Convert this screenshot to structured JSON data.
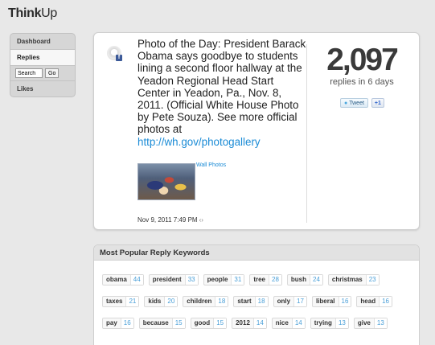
{
  "app": {
    "logo_think": "Think",
    "logo_up": "Up"
  },
  "sidebar": {
    "items": [
      {
        "label": "Dashboard"
      },
      {
        "label": "Replies"
      },
      {
        "label": "Likes"
      }
    ],
    "search_value": "Search",
    "go_label": "Go"
  },
  "post": {
    "text": "Photo of the Day: President Barack Obama says goodbye to students lining a second floor hallway at the Yeadon Regional Head Start Center in Yeadon, Pa., Nov. 8, 2011. (Official White House Photo by Pete Souza). See more official photos at",
    "link": "http://wh.gov/photogallery",
    "photo_caption": "Wall Photos",
    "timestamp": "Nov 9, 2011 7:49 PM",
    "source_badge": "f"
  },
  "stats": {
    "count": "2,097",
    "label": "replies in 6 days",
    "tweet_label": "Tweet",
    "plus_label": "+1"
  },
  "keywords": {
    "title": "Most Popular Reply Keywords",
    "rows": [
      [
        {
          "word": "obama",
          "count": "44"
        },
        {
          "word": "president",
          "count": "33"
        },
        {
          "word": "people",
          "count": "31"
        },
        {
          "word": "tree",
          "count": "28"
        },
        {
          "word": "bush",
          "count": "24"
        },
        {
          "word": "christmas",
          "count": "23"
        }
      ],
      [
        {
          "word": "taxes",
          "count": "21"
        },
        {
          "word": "kids",
          "count": "20"
        },
        {
          "word": "children",
          "count": "18"
        },
        {
          "word": "start",
          "count": "18"
        },
        {
          "word": "only",
          "count": "17"
        },
        {
          "word": "liberal",
          "count": "16"
        },
        {
          "word": "head",
          "count": "16"
        }
      ],
      [
        {
          "word": "pay",
          "count": "16"
        },
        {
          "word": "because",
          "count": "15"
        },
        {
          "word": "good",
          "count": "15"
        },
        {
          "word": "2012",
          "count": "14"
        },
        {
          "word": "nice",
          "count": "14"
        },
        {
          "word": "trying",
          "count": "13"
        },
        {
          "word": "give",
          "count": "13"
        }
      ]
    ]
  }
}
